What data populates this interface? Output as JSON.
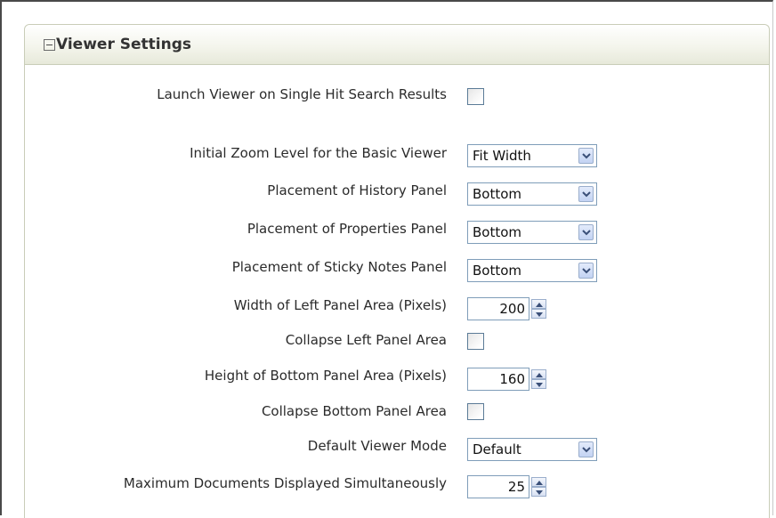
{
  "panel": {
    "title": "Viewer Settings",
    "collapse_icon": "minus-box-icon"
  },
  "settings": [
    {
      "id": "launch_viewer_single_hit",
      "label": "Launch Viewer on Single Hit Search Results",
      "type": "checkbox",
      "checked": false
    },
    {
      "id": "initial_zoom_level",
      "label": "Initial Zoom Level for the Basic Viewer",
      "type": "select",
      "value": "Fit Width"
    },
    {
      "id": "history_panel_placement",
      "label": "Placement of History Panel",
      "type": "select",
      "value": "Bottom"
    },
    {
      "id": "properties_panel_placement",
      "label": "Placement of Properties Panel",
      "type": "select",
      "value": "Bottom"
    },
    {
      "id": "sticky_notes_panel_placement",
      "label": "Placement of Sticky Notes Panel",
      "type": "select",
      "value": "Bottom"
    },
    {
      "id": "left_panel_width",
      "label": "Width of Left Panel Area (Pixels)",
      "type": "spinner",
      "value": "200"
    },
    {
      "id": "collapse_left_panel",
      "label": "Collapse Left Panel Area",
      "type": "checkbox",
      "checked": false
    },
    {
      "id": "bottom_panel_height",
      "label": "Height of Bottom Panel Area (Pixels)",
      "type": "spinner",
      "value": "160"
    },
    {
      "id": "collapse_bottom_panel",
      "label": "Collapse Bottom Panel Area",
      "type": "checkbox",
      "checked": false
    },
    {
      "id": "default_viewer_mode",
      "label": "Default Viewer Mode",
      "type": "select",
      "value": "Default"
    },
    {
      "id": "max_documents",
      "label": "Maximum Documents Displayed Simultaneously",
      "type": "spinner",
      "value": "25"
    }
  ],
  "icons": {
    "select_arrow": "chevron-down-icon",
    "spin_up": "triangle-up-icon",
    "spin_down": "triangle-down-icon"
  },
  "colors": {
    "border_dark": "#4a4a4a",
    "panel_border": "#c9cdb8",
    "header_gradient_bottom": "#e7e9da",
    "control_border": "#7f9db9",
    "checkbox_border": "#5b7b97",
    "button_blue": "#c3d3f3"
  }
}
